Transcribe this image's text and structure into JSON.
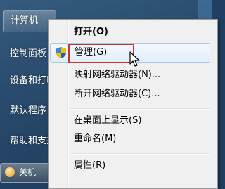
{
  "start_pane": {
    "items": [
      {
        "label": "计算机"
      },
      {
        "label": "控制面板"
      },
      {
        "label": "设备和打印机"
      },
      {
        "label": "默认程序"
      },
      {
        "label": "帮助和支持"
      }
    ],
    "shutdown_label": "关机"
  },
  "context_menu": {
    "items": [
      {
        "label": "打开(O)",
        "bold": true
      },
      {
        "label": "管理(G)",
        "highlighted": true,
        "icon": "uac-shield-icon"
      },
      {
        "label": "映射网络驱动器(N)..."
      },
      {
        "label": "断开网络驱动器(C)..."
      },
      {
        "label": "在桌面上显示(S)"
      },
      {
        "label": "重命名(M)"
      },
      {
        "label": "属性(R)"
      }
    ]
  },
  "colors": {
    "highlight_border": "#c8342e",
    "menu_background": "#f0f0f0"
  }
}
